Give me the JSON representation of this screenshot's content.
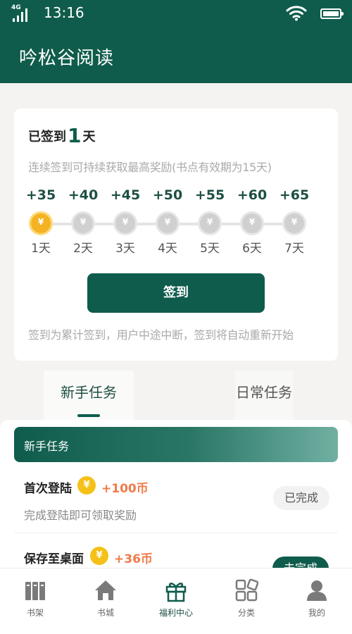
{
  "status_bar": {
    "network": "4G",
    "time": "13:16",
    "icons": [
      "signal-icon",
      "wifi-icon",
      "battery-icon"
    ]
  },
  "app_bar": {
    "title": "吟松谷阅读"
  },
  "signin_card": {
    "signed_prefix": "已签到",
    "signed_days": "1",
    "signed_suffix": "天",
    "hint": "连续签到可持续获取最高奖励(书点有效期为15天)",
    "coin_symbol": "¥",
    "rewards": [
      {
        "amount": "+35",
        "day": "1天",
        "signed": true
      },
      {
        "amount": "+40",
        "day": "2天",
        "signed": false
      },
      {
        "amount": "+45",
        "day": "3天",
        "signed": false
      },
      {
        "amount": "+50",
        "day": "4天",
        "signed": false
      },
      {
        "amount": "+55",
        "day": "5天",
        "signed": false
      },
      {
        "amount": "+60",
        "day": "6天",
        "signed": false
      },
      {
        "amount": "+65",
        "day": "7天",
        "signed": false
      }
    ],
    "button_label": "签到",
    "notice": "签到为累计签到，用户中途中断，签到将自动重新开始"
  },
  "tabs": [
    {
      "label": "新手任务",
      "active": true
    },
    {
      "label": "日常任务",
      "active": false
    }
  ],
  "task_section": {
    "header": "新手任务",
    "tasks": [
      {
        "title": "首次登陆",
        "reward": "+100币",
        "description": "完成登陆即可领取奖励",
        "status": "已完成"
      },
      {
        "title": "保存至桌面",
        "reward": "+36币",
        "description": "",
        "status": "去完成"
      }
    ]
  },
  "bottom_nav": [
    {
      "label": "书架",
      "icon": "bookshelf-icon",
      "active": false
    },
    {
      "label": "书城",
      "icon": "home-icon",
      "active": false
    },
    {
      "label": "福利中心",
      "icon": "gift-icon",
      "active": true
    },
    {
      "label": "分类",
      "icon": "grid-icon",
      "active": false
    },
    {
      "label": "我的",
      "icon": "user-icon",
      "active": false
    }
  ],
  "colors": {
    "primary": "#0f5c4c",
    "coin_gold": "#f4b322",
    "reward_orange": "#f07b4a",
    "muted_text": "#aaaaaa"
  }
}
